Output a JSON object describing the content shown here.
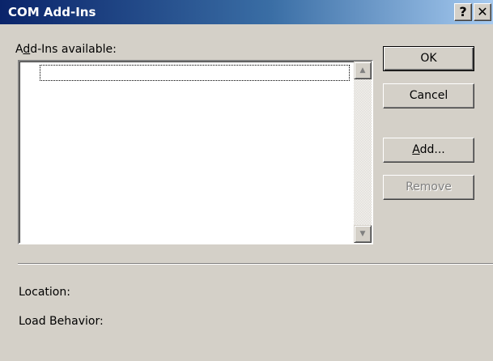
{
  "window": {
    "title": "COM Add-Ins",
    "help_glyph": "?",
    "close_glyph": "✕"
  },
  "addins": {
    "label_prefix": "A",
    "label_mnemonic": "d",
    "label_rest": "d-Ins available:",
    "items": [],
    "scroll_up_glyph": "▲",
    "scroll_down_glyph": "▼"
  },
  "buttons": {
    "ok": "OK",
    "cancel": "Cancel",
    "add_mnemonic": "A",
    "add_rest": "dd...",
    "remove": "Remove",
    "remove_enabled": false
  },
  "details": {
    "location_label": "Location:",
    "load_behavior_label": "Load Behavior:"
  },
  "colors": {
    "title_start": "#0a246a",
    "title_end": "#a6caf0",
    "face": "#d4d0c8",
    "disabled_text": "#808080"
  },
  "icons": {
    "help": "help-icon",
    "close": "close-icon",
    "scroll_up": "arrow-up-icon",
    "scroll_down": "arrow-down-icon"
  }
}
